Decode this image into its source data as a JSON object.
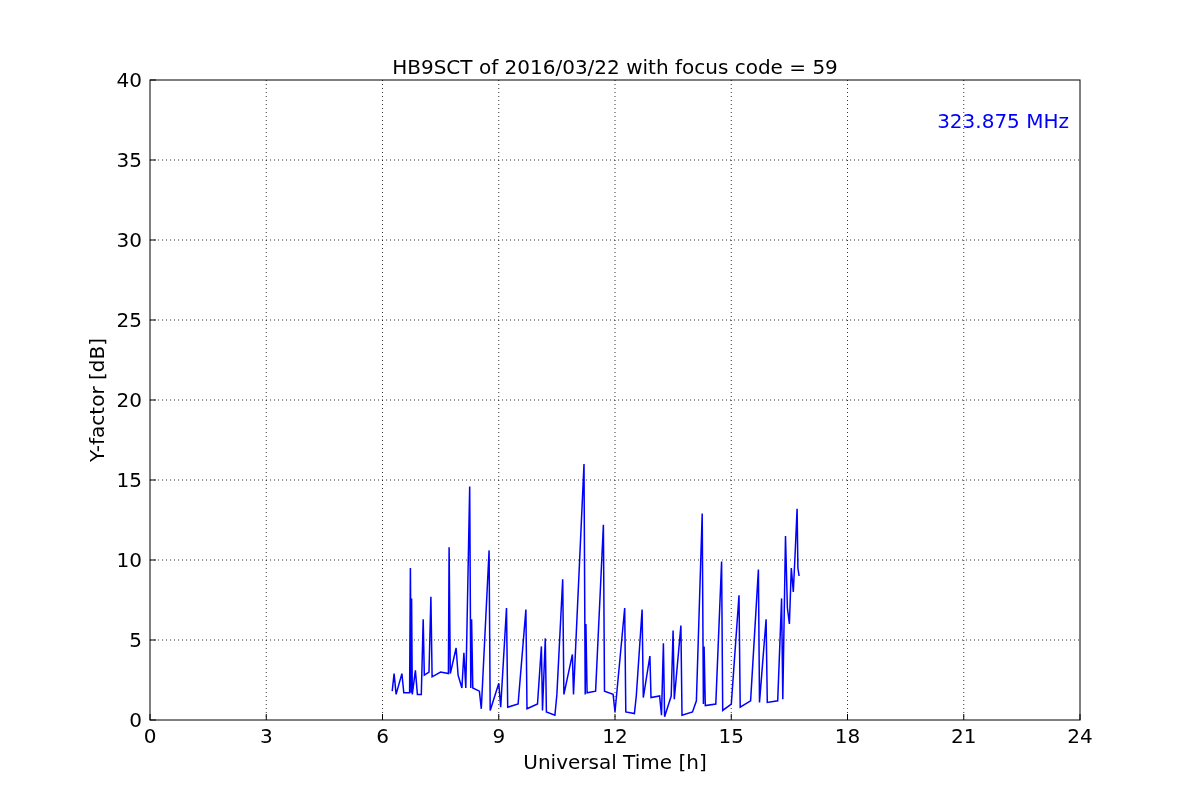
{
  "chart_data": {
    "type": "line",
    "title": "HB9SCT of 2016/03/22 with focus code = 59",
    "xlabel": "Universal Time [h]",
    "ylabel": "Y-factor [dB]",
    "xlim": [
      0,
      24
    ],
    "ylim": [
      0,
      40
    ],
    "xticks": [
      0,
      3,
      6,
      9,
      12,
      15,
      18,
      21,
      24
    ],
    "yticks": [
      0,
      5,
      10,
      15,
      20,
      25,
      30,
      35,
      40
    ],
    "grid": true,
    "annotations": [
      {
        "text": "323.875 MHz"
      }
    ],
    "x": [
      6.25,
      6.3,
      6.35,
      6.5,
      6.55,
      6.7,
      6.72,
      6.74,
      6.75,
      6.77,
      6.85,
      6.9,
      7.0,
      7.05,
      7.08,
      7.2,
      7.25,
      7.28,
      7.5,
      7.7,
      7.72,
      7.75,
      7.9,
      7.95,
      8.05,
      8.1,
      8.15,
      8.25,
      8.28,
      8.3,
      8.33,
      8.5,
      8.55,
      8.75,
      8.78,
      9.0,
      9.05,
      9.2,
      9.23,
      9.5,
      9.7,
      9.73,
      10.0,
      10.1,
      10.13,
      10.2,
      10.23,
      10.45,
      10.5,
      10.65,
      10.68,
      10.9,
      10.93,
      11.2,
      11.23,
      11.25,
      11.28,
      11.5,
      11.7,
      11.73,
      11.95,
      12.0,
      12.25,
      12.28,
      12.5,
      12.55,
      12.7,
      12.73,
      12.9,
      12.93,
      13.15,
      13.2,
      13.25,
      13.28,
      13.45,
      13.5,
      13.53,
      13.7,
      13.73,
      14.0,
      14.1,
      14.25,
      14.28,
      14.3,
      14.33,
      14.6,
      14.75,
      14.78,
      15.0,
      15.2,
      15.23,
      15.5,
      15.7,
      15.73,
      15.9,
      15.93,
      16.2,
      16.3,
      16.33,
      16.4,
      16.45,
      16.5,
      16.55,
      16.6,
      16.65,
      16.7,
      16.72,
      16.75
    ],
    "series": [
      {
        "color": "#0000ff",
        "values": [
          1.8,
          2.9,
          1.6,
          2.9,
          1.7,
          1.7,
          9.5,
          1.7,
          7.6,
          1.6,
          3.1,
          1.6,
          1.6,
          6.3,
          2.8,
          3.0,
          7.7,
          2.7,
          3.0,
          2.9,
          10.8,
          2.9,
          4.5,
          2.8,
          2.0,
          4.2,
          2.0,
          14.6,
          2.0,
          6.3,
          2.0,
          1.8,
          0.7,
          10.6,
          0.6,
          2.3,
          0.8,
          7.0,
          0.8,
          1.0,
          6.9,
          0.7,
          1.0,
          4.6,
          0.6,
          5.1,
          0.5,
          0.3,
          1.6,
          8.8,
          1.6,
          4.1,
          1.6,
          16.0,
          1.6,
          6.0,
          1.7,
          1.8,
          12.2,
          1.8,
          1.6,
          0.5,
          7.0,
          0.5,
          0.4,
          1.5,
          6.9,
          1.4,
          4.0,
          1.4,
          1.5,
          0.3,
          4.8,
          0.2,
          1.5,
          5.6,
          1.3,
          5.9,
          0.3,
          0.5,
          1.2,
          12.9,
          1.0,
          4.6,
          0.9,
          1.0,
          9.9,
          0.6,
          1.0,
          7.8,
          0.8,
          1.2,
          9.4,
          1.1,
          6.3,
          1.1,
          1.2,
          7.6,
          1.3,
          11.5,
          7.0,
          6.0,
          9.5,
          8.0,
          10.5,
          13.2,
          9.5,
          9.0
        ]
      }
    ]
  }
}
